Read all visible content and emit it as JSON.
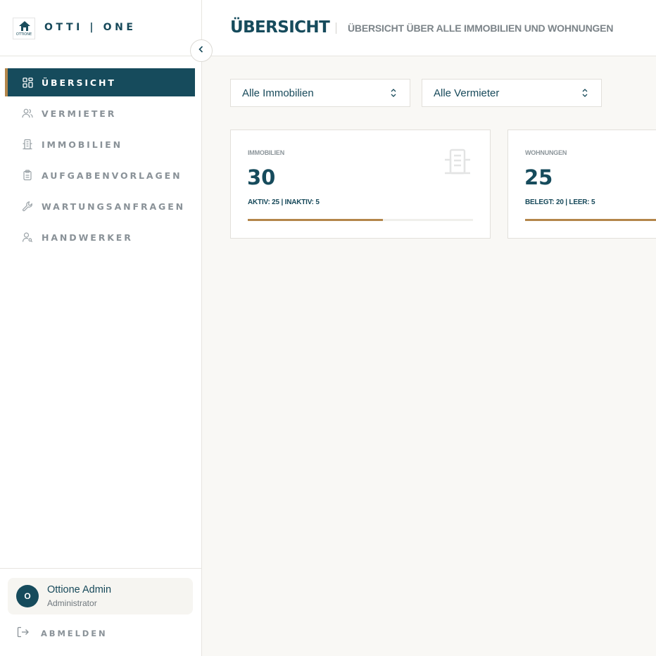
{
  "brand": {
    "name": "OTTI | ONE",
    "logo_text": "OTTIONE"
  },
  "sidebar": {
    "items": [
      {
        "label": "ÜBERSICHT",
        "icon": "grid-icon",
        "active": true
      },
      {
        "label": "VERMIETER",
        "icon": "users-icon",
        "active": false
      },
      {
        "label": "IMMOBILIEN",
        "icon": "building-icon",
        "active": false
      },
      {
        "label": "AUFGABENVORLAGEN",
        "icon": "clipboard-icon",
        "active": false
      },
      {
        "label": "WARTUNGSANFRAGEN",
        "icon": "wrench-icon",
        "active": false
      },
      {
        "label": "HANDWERKER",
        "icon": "user-search-icon",
        "active": false
      }
    ],
    "user": {
      "initial": "O",
      "name": "Ottione Admin",
      "role": "Administrator"
    },
    "logout_label": "ABMELDEN"
  },
  "header": {
    "title": "ÜBERSICHT",
    "subtitle": "ÜBERSICHT ÜBER ALLE IMMOBILIEN UND WOHNUNGEN"
  },
  "filters": {
    "immobilien": {
      "value": "Alle Immobilien"
    },
    "vermieter": {
      "value": "Alle Vermieter"
    }
  },
  "stats": [
    {
      "label": "IMMOBILIEN",
      "value": "30",
      "detail": "AKTIV: 25 | INAKTIV: 5",
      "progress": 0.6
    },
    {
      "label": "WOHNUNGEN",
      "value": "25",
      "detail": "BELEGT: 20 | LEER: 5",
      "progress": 0.8
    }
  ],
  "colors": {
    "primary": "#164b5c",
    "accent": "#b4864a",
    "background": "#f9f8f5"
  }
}
